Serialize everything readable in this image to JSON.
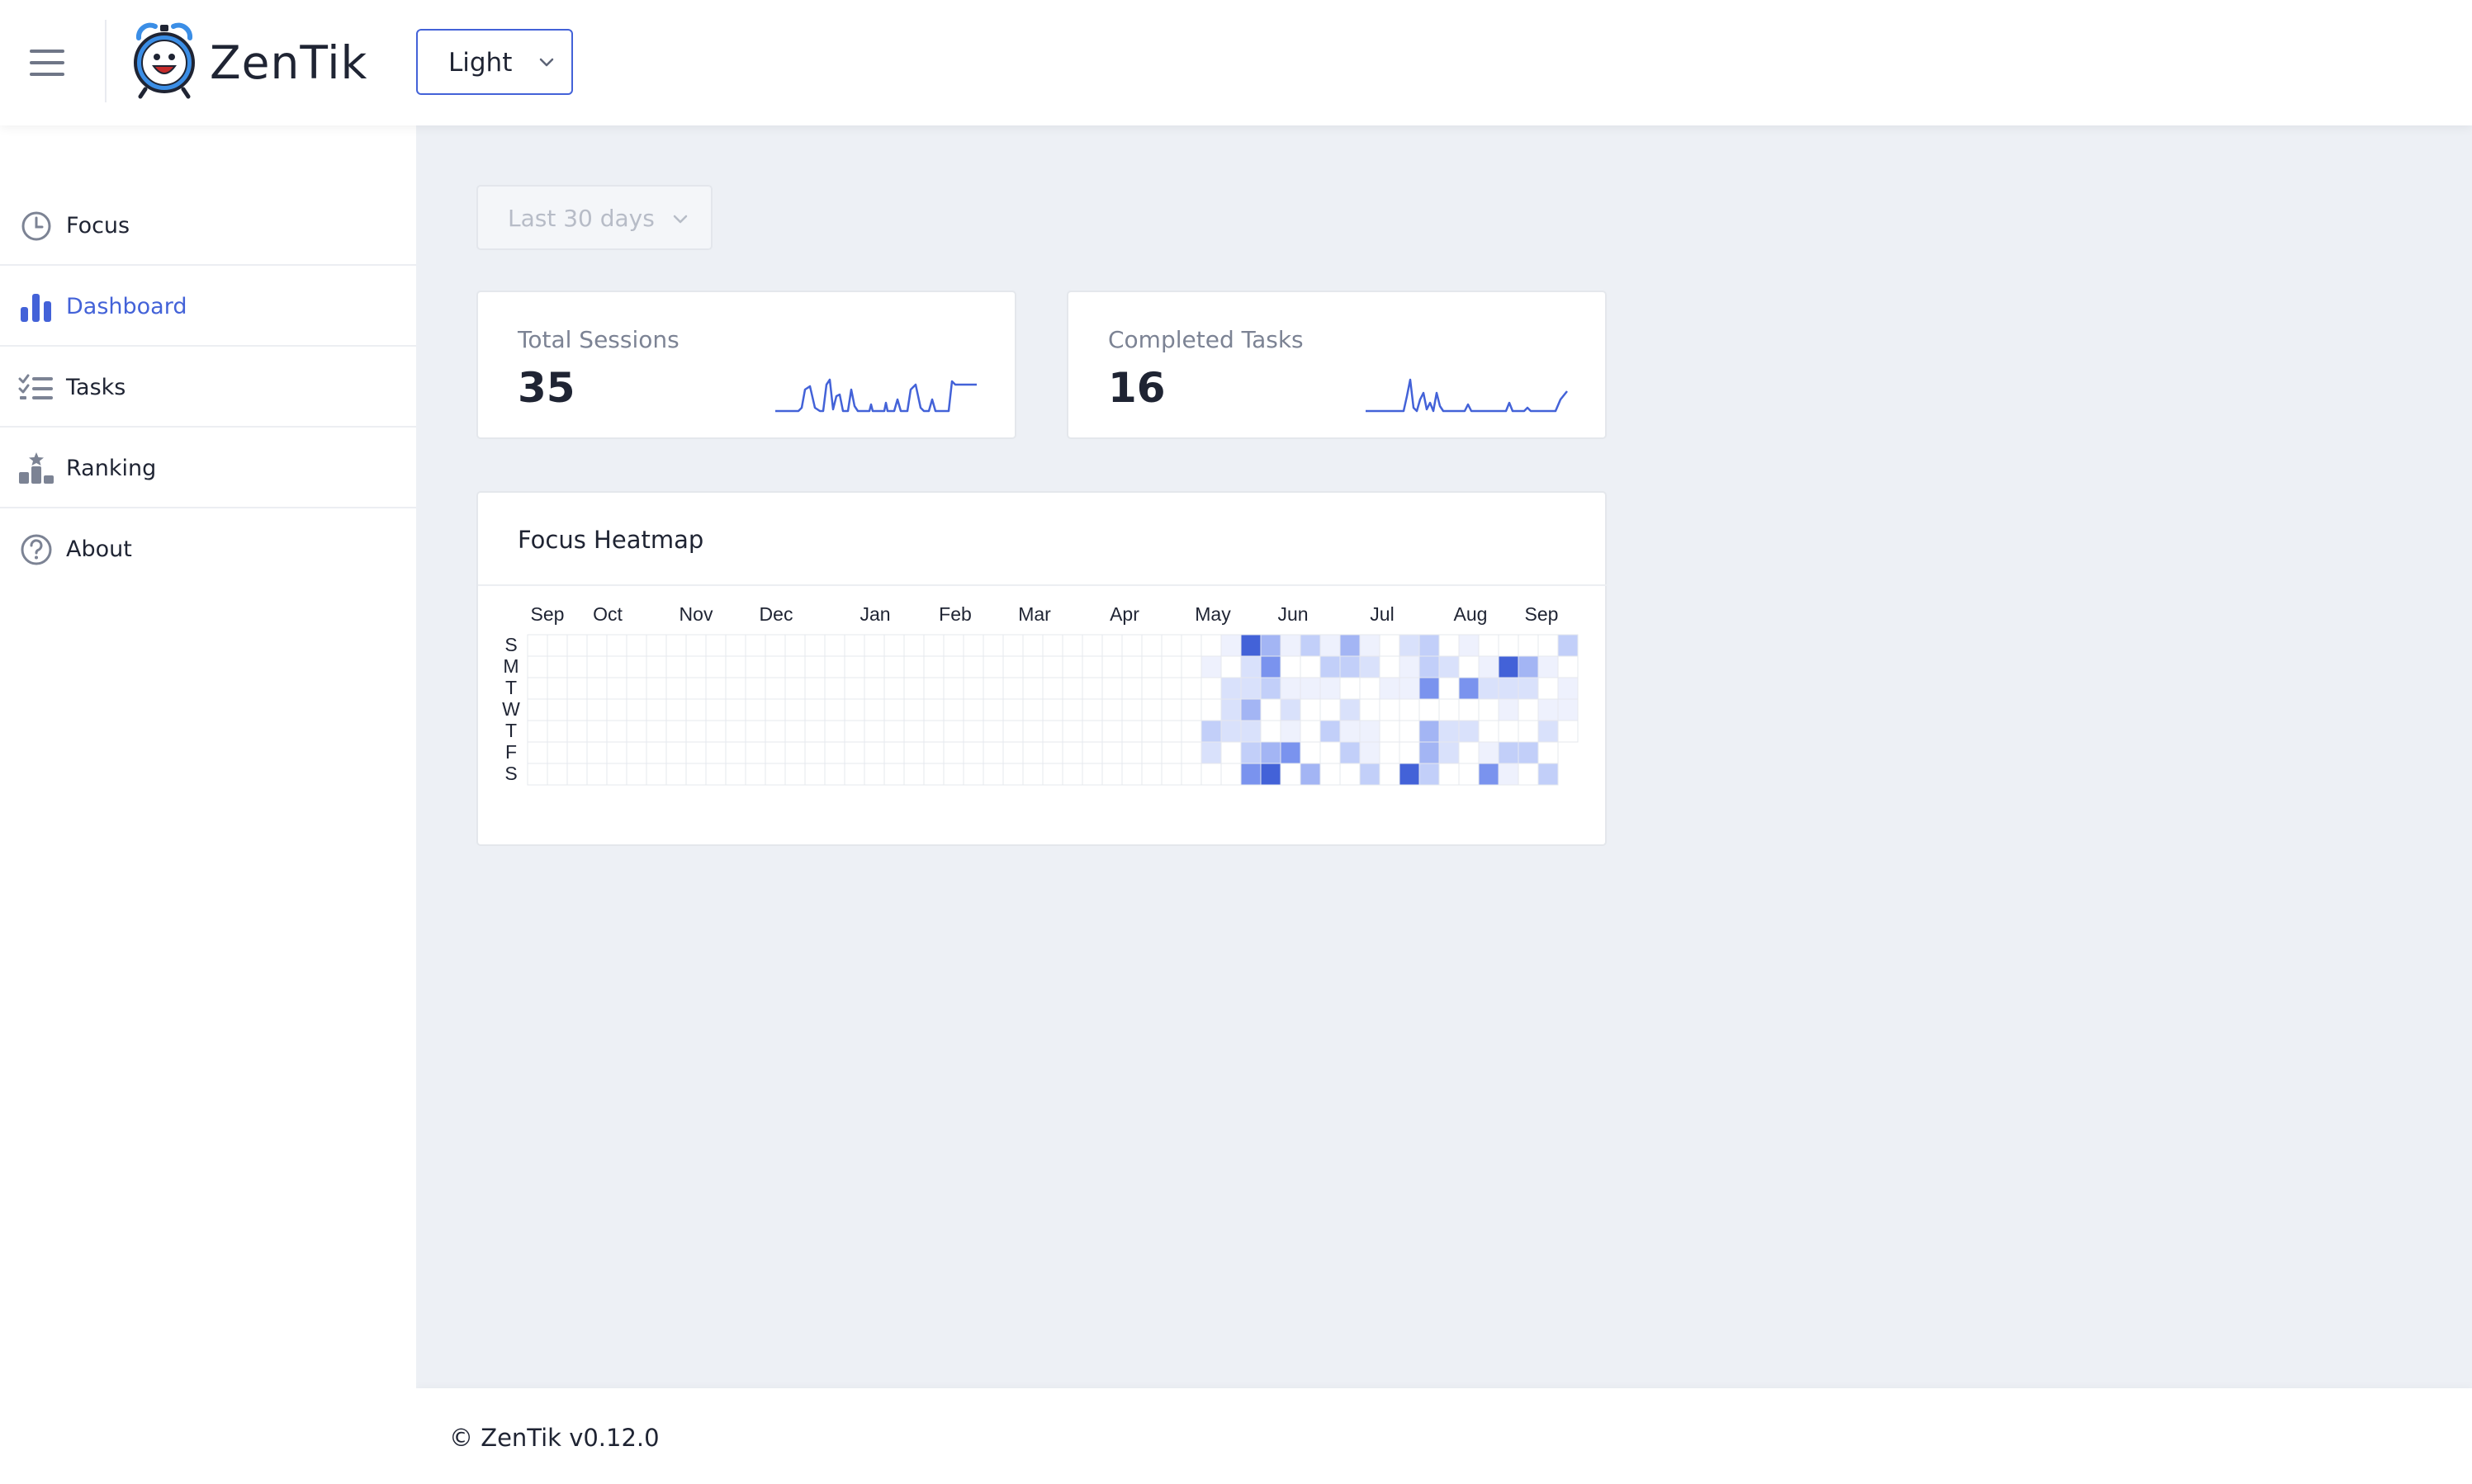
{
  "app": {
    "name": "ZenTik",
    "theme": "Light"
  },
  "sidebar": {
    "items": [
      {
        "label": "Focus",
        "icon": "clock-icon",
        "active": false
      },
      {
        "label": "Dashboard",
        "icon": "bar-chart-icon",
        "active": true
      },
      {
        "label": "Tasks",
        "icon": "checklist-icon",
        "active": false
      },
      {
        "label": "Ranking",
        "icon": "podium-icon",
        "active": false
      },
      {
        "label": "About",
        "icon": "question-circle-icon",
        "active": false
      }
    ]
  },
  "filters": {
    "range": "Last 30 days"
  },
  "stats": [
    {
      "label": "Total Sessions",
      "value": "35"
    },
    {
      "label": "Completed Tasks",
      "value": "16"
    }
  ],
  "heatmap": {
    "title": "Focus Heatmap",
    "months": [
      "Sep",
      "Oct",
      "Nov",
      "Dec",
      "Jan",
      "Feb",
      "Mar",
      "Apr",
      "May",
      "Jun",
      "Jul",
      "Aug",
      "Sep"
    ],
    "weekdays": [
      "S",
      "M",
      "T",
      "W",
      "T",
      "F",
      "S"
    ]
  },
  "colors": {
    "accent": "#4362d8",
    "heat_levels": [
      "#ffffff",
      "#eef1fd",
      "#d9e1fb",
      "#c2cff9",
      "#a3b5f4",
      "#7a93ee",
      "#4362d8"
    ]
  },
  "footer": {
    "text": "© ZenTik v0.12.0"
  }
}
